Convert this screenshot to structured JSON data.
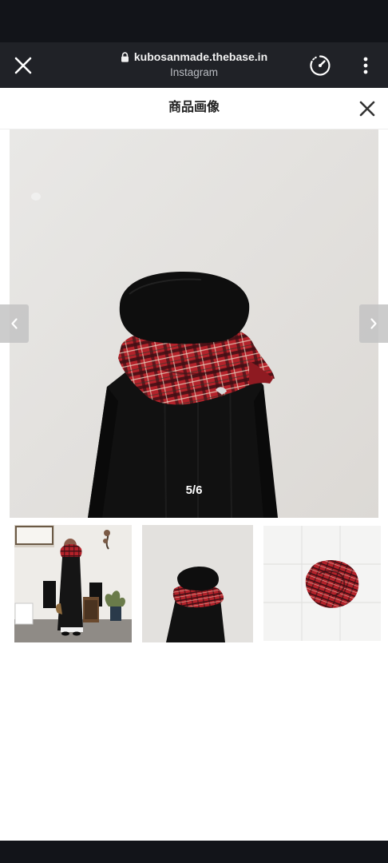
{
  "browser": {
    "url": "kubosanmade.thebase.in",
    "subtitle": "Instagram"
  },
  "modal": {
    "title": "商品画像"
  },
  "gallery": {
    "counter": "5/6",
    "main_image": "beret-and-plaid-scarf-on-mannequin",
    "thumbnails": [
      {
        "image": "person-in-black-coat-with-red-scarf",
        "selected": false
      },
      {
        "image": "mannequin-with-beret-and-scarf",
        "selected": true
      },
      {
        "image": "rolled-red-plaid-scarf",
        "selected": false
      }
    ]
  },
  "colors": {
    "status_bar": "#121419",
    "browser_bar": "#202227",
    "tartan_red": "#b3222a",
    "garment_black": "#121212"
  },
  "icons": {
    "browser_close": "close-icon",
    "lock": "lock-icon",
    "speed": "speedometer-icon",
    "more": "more-vertical-icon",
    "modal_close": "close-icon",
    "prev": "chevron-left-icon",
    "next": "chevron-right-icon"
  }
}
